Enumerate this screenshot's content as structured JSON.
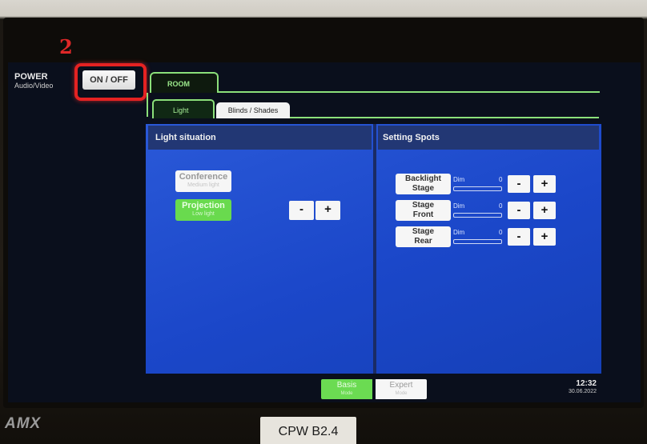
{
  "overlay": {
    "step_number": "2"
  },
  "power": {
    "title": "POWER",
    "subtitle": "Audio/Video",
    "button_label": "ON / OFF"
  },
  "tabs": {
    "room": "ROOM",
    "light": "Light",
    "blinds": "Blinds / Shades"
  },
  "light_situation": {
    "header": "Light situation",
    "presets": [
      {
        "label": "Conference",
        "sub": "Medium light",
        "active": false
      },
      {
        "label": "Projection",
        "sub": "Low light",
        "active": true
      }
    ],
    "minus": "-",
    "plus": "+"
  },
  "setting_spots": {
    "header": "Setting Spots",
    "spots": [
      {
        "line1": "Backlight",
        "line2": "Stage",
        "dim_label": "Dim",
        "value": "0",
        "level": 0,
        "minus": "-",
        "plus": "+"
      },
      {
        "line1": "Stage",
        "line2": "Front",
        "dim_label": "Dim",
        "value": "0",
        "level": 0,
        "minus": "-",
        "plus": "+"
      },
      {
        "line1": "Stage",
        "line2": "Rear",
        "dim_label": "Dim",
        "value": "0",
        "level": 0,
        "minus": "-",
        "plus": "+"
      }
    ]
  },
  "footer": {
    "modes": [
      {
        "label": "Basis",
        "sub": "Mode",
        "active": true
      },
      {
        "label": "Expert",
        "sub": "Mode",
        "active": false
      }
    ],
    "time": "12:32",
    "date": "30.06.2022"
  },
  "device": {
    "brand": "AMX",
    "room_label": "CPW B2.4"
  },
  "colors": {
    "panel_blue": "#1b47c9",
    "header_navy": "#223774",
    "tab_green": "#8be07a",
    "active_green": "#69da4e",
    "highlight_red": "#e52222"
  }
}
